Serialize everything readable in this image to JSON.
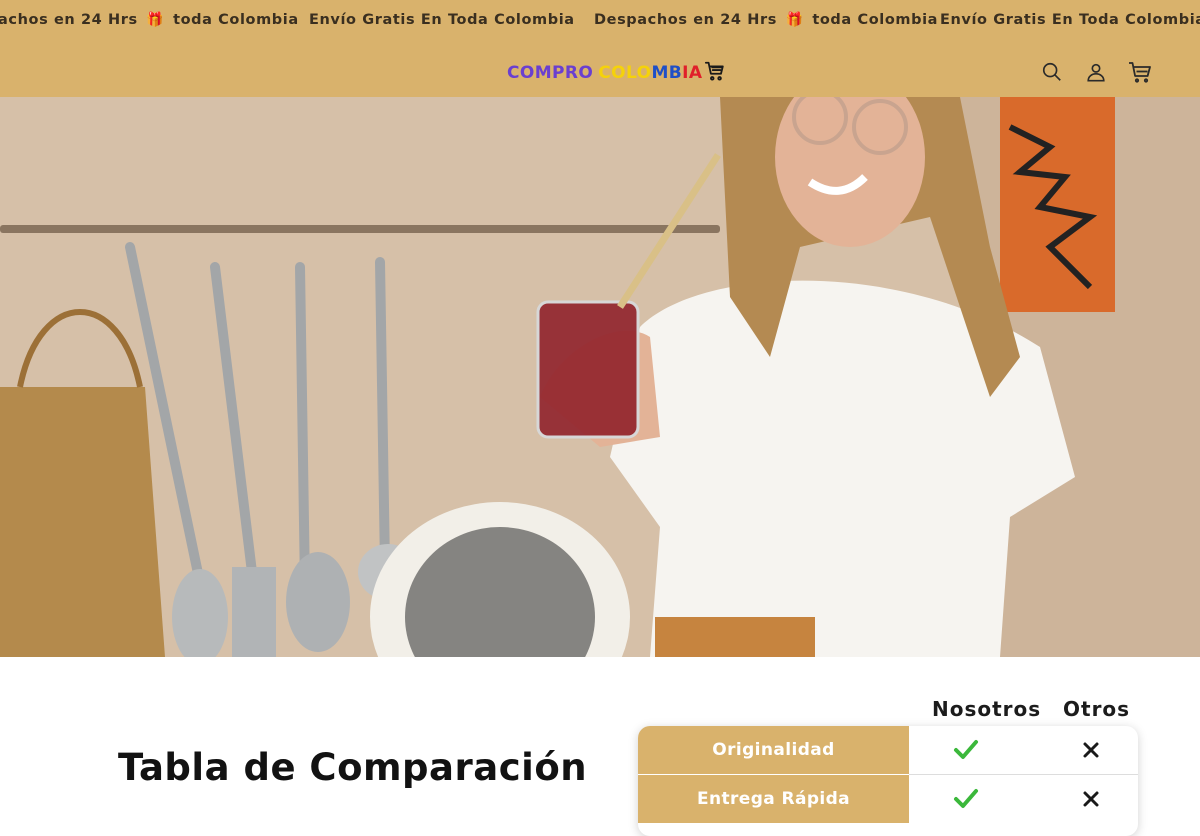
{
  "announcement": {
    "messages": [
      {
        "text_before": "achos en 24 Hrs",
        "gift": true,
        "text_after": "toda Colombia"
      },
      {
        "text_before": "Envío Gratis En Toda Colombia",
        "gift": false,
        "text_after": ""
      },
      {
        "text_before": "Despachos en 24 Hrs",
        "gift": true,
        "text_after": "toda Colombia"
      },
      {
        "text_before": "Envío Gratis En Toda Colombia",
        "gift": false,
        "text_after": ""
      }
    ]
  },
  "header": {
    "logo": {
      "word1": "COMPRO",
      "word2_part_yellow": "COLO",
      "word2_part_blue": "MB",
      "word2_part_red": "IA"
    },
    "icons": [
      "search-icon",
      "account-icon",
      "cart-icon"
    ]
  },
  "hero": {
    "image_alt": "Mujer sonriendo sosteniendo un vaso con pitillo en una cocina"
  },
  "comparison": {
    "title": "Tabla de Comparación",
    "col_us": "Nosotros",
    "col_others": "Otros",
    "rows": [
      {
        "label": "Originalidad",
        "us": "check",
        "others": "cross"
      },
      {
        "label": "Entrega Rápida",
        "us": "check",
        "others": "cross"
      }
    ]
  },
  "colors": {
    "brand_tan": "#d9b26c",
    "check_green": "#3bb83b",
    "cross_dark": "#1a1a1a"
  }
}
